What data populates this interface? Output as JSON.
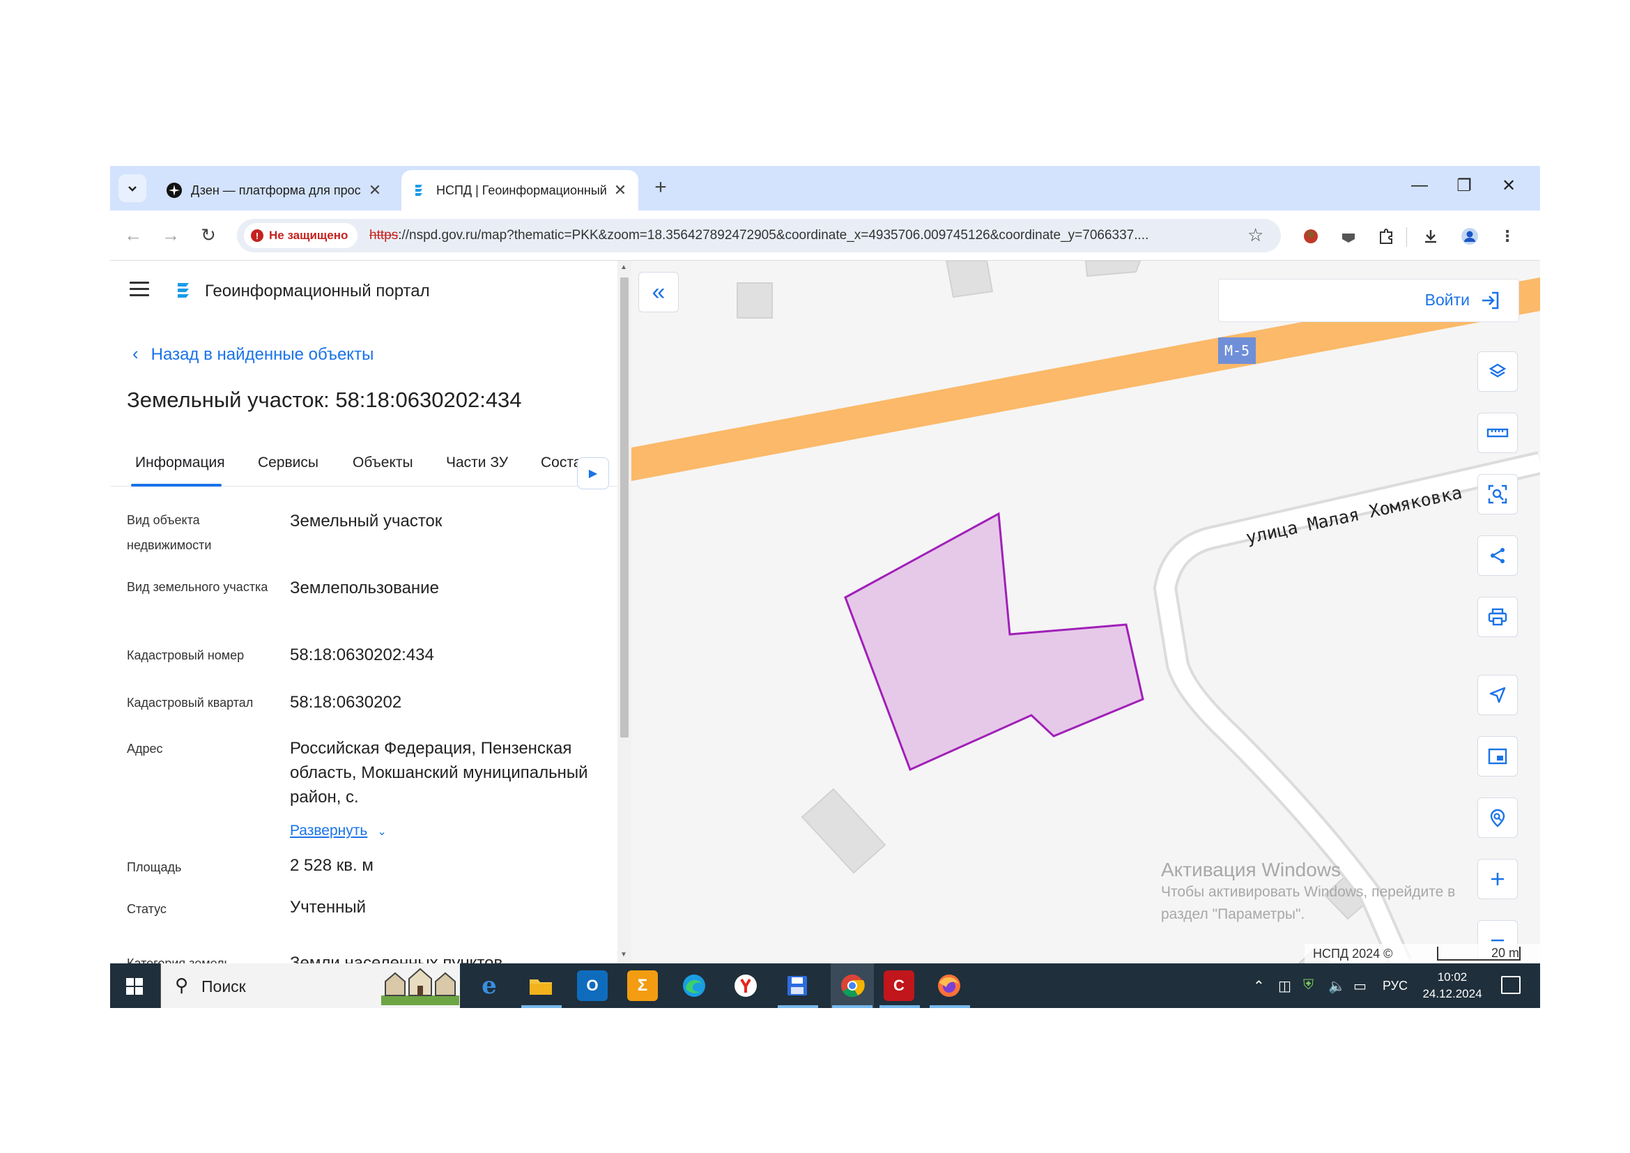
{
  "browser": {
    "tabs": [
      {
        "title": "Дзен — платформа для просмотра",
        "active": false
      },
      {
        "title": "НСПД | Геоинформационный портал",
        "active": true
      }
    ],
    "security_label": "Не защищено",
    "url_scheme": "https",
    "url_rest": "://nspd.gov.ru/map?thematic=PKK&zoom=18.356427892472905&coordinate_x=4935706.009745126&coordinate_y=7066337....",
    "icons": [
      "chevron-down-icon",
      "close-icon",
      "plus-icon",
      "minimize-icon",
      "restore-icon",
      "back-icon",
      "forward-icon",
      "reload-icon",
      "star-icon",
      "extensions-icon",
      "download-icon",
      "profile-icon",
      "menu-dots-icon"
    ]
  },
  "portal": {
    "title": "Геоинформационный портал",
    "back_label": "Назад в найденные объекты",
    "parcel_title": "Земельный участок: 58:18:0630202:434"
  },
  "tabs": [
    "Информация",
    "Сервисы",
    "Объекты",
    "Части ЗУ",
    "Соста"
  ],
  "info_rows": [
    {
      "label": "Вид объекта недвижимости",
      "value": "Земельный участок"
    },
    {
      "label": "Вид земельного участка",
      "value": "Землепользование"
    },
    {
      "label": "Кадастровый номер",
      "value": "58:18:0630202:434"
    },
    {
      "label": "Кадастровый квартал",
      "value": "58:18:0630202"
    },
    {
      "label": "Адрес",
      "value": "Российская Федерация, Пензенская область, Мокшанский муниципальный район, с."
    },
    {
      "label": "Площадь",
      "value": "2 528 кв. м"
    },
    {
      "label": "Статус",
      "value": "Учтенный"
    },
    {
      "label": "Категория земель",
      "value": "Земли населенных пунктов"
    }
  ],
  "expand_label": "Развернуть",
  "map": {
    "login_label": "Войти",
    "road_badge": "M-5",
    "street_label": "улица Малая Хомяковка",
    "watermark_title": "Активация Windows",
    "watermark_line1": "Чтобы активировать Windows, перейдите в",
    "watermark_line2": "раздел \"Параметры\".",
    "attribution": "НСПД 2024 ©",
    "scale_label": "20 m",
    "parcel_fill": "#e6c9e8",
    "parcel_stroke": "#a020b8",
    "road_color": "#fbb969",
    "accent": "#1a73e8"
  },
  "taskbar": {
    "search_label": "Поиск",
    "lang": "РУС",
    "time": "10:02",
    "date": "24.12.2024"
  }
}
